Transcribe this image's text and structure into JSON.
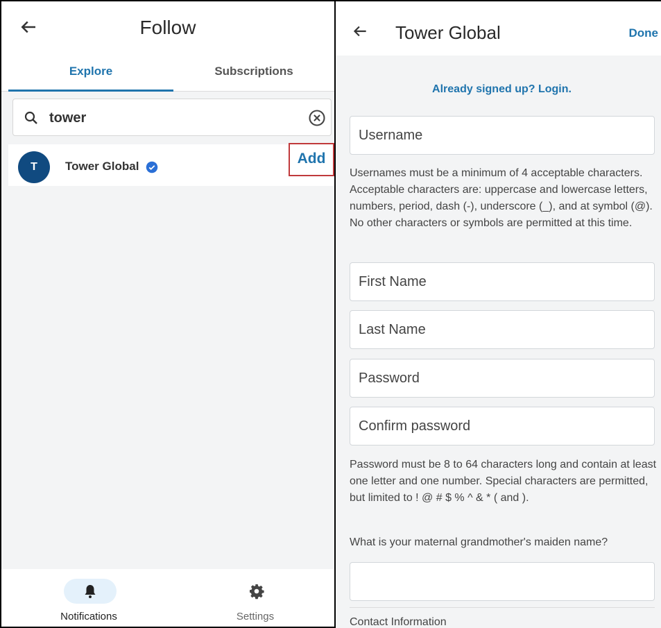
{
  "left": {
    "header": {
      "title": "Follow"
    },
    "tabs": [
      {
        "label": "Explore",
        "selected": true
      },
      {
        "label": "Subscriptions",
        "selected": false
      }
    ],
    "search": {
      "value": "tower",
      "placeholder": ""
    },
    "results": [
      {
        "initial": "T",
        "name": "Tower Global",
        "verified": true,
        "action_label": "Add"
      }
    ],
    "bottom_nav": [
      {
        "label": "Notifications",
        "icon": "bell-icon",
        "active": true
      },
      {
        "label": "Settings",
        "icon": "gear-icon",
        "active": false
      }
    ]
  },
  "right": {
    "header": {
      "title": "Tower Global",
      "done_label": "Done"
    },
    "login_link": "Already signed up? Login.",
    "fields": {
      "username": {
        "placeholder": "Username",
        "value": ""
      },
      "first_name": {
        "placeholder": "First Name",
        "value": ""
      },
      "last_name": {
        "placeholder": "Last Name",
        "value": ""
      },
      "password": {
        "placeholder": "Password",
        "value": ""
      },
      "confirm_password": {
        "placeholder": "Confirm password",
        "value": ""
      },
      "maiden_name": {
        "placeholder": "",
        "value": ""
      }
    },
    "username_help": "Usernames must be a minimum of 4 acceptable characters. Acceptable characters are: uppercase and lowercase letters, numbers, period, dash (-), underscore (_), and at symbol (@). No other characters or symbols are permitted at this time.",
    "password_help": "Password must be 8 to 64 characters long and contain at least one letter and one number. Special characters are permitted, but limited to ! @ # $ % ^ & * ( and ).",
    "security_question": "What is your maternal grandmother's maiden name?",
    "section_title": "Contact Information"
  },
  "colors": {
    "accent": "#1f74ad",
    "avatar_bg": "#104a80",
    "highlight_border": "#c0393b",
    "nav_active_pill": "#e4f1fb",
    "background": "#f3f4f5"
  }
}
